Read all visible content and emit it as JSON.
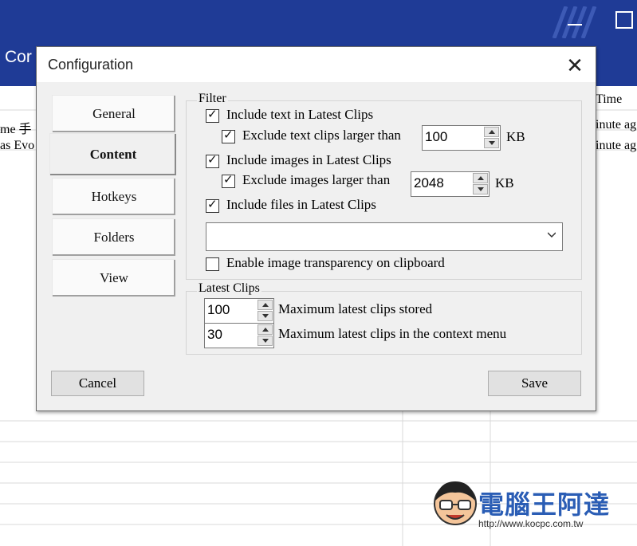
{
  "background": {
    "app_title_partial": "Cor",
    "column_header_partial": "Time",
    "row1_left_partial": "me 手",
    "row2_left_partial": "as Evo",
    "row1_right_partial": "inute ag",
    "row2_right_partial": "inute ag"
  },
  "dialog": {
    "title": "Configuration",
    "close_glyph": "✕"
  },
  "tabs": [
    {
      "label": "General",
      "active": false
    },
    {
      "label": "Content",
      "active": true
    },
    {
      "label": "Hotkeys",
      "active": false
    },
    {
      "label": "Folders",
      "active": false
    },
    {
      "label": "View",
      "active": false
    }
  ],
  "filter": {
    "group_label": "Filter",
    "include_text": {
      "label": "Include text in Latest Clips",
      "checked": true
    },
    "exclude_text": {
      "label": "Exclude text clips larger than",
      "checked": true,
      "value": "100",
      "unit": "KB"
    },
    "include_images": {
      "label": "Include images in Latest Clips",
      "checked": true
    },
    "exclude_images": {
      "label": "Exclude images larger than",
      "checked": true,
      "value": "2048",
      "unit": "KB"
    },
    "include_files": {
      "label": "Include files in Latest Clips",
      "checked": true
    },
    "dropdown_value": "",
    "transparency": {
      "label": "Enable image transparency on clipboard",
      "checked": false
    }
  },
  "latest_clips": {
    "group_label": "Latest Clips",
    "max_stored": {
      "value": "100",
      "label": "Maximum latest clips stored"
    },
    "max_context": {
      "value": "30",
      "label": "Maximum latest clips in the context menu"
    }
  },
  "buttons": {
    "cancel": "Cancel",
    "save": "Save"
  },
  "watermark": {
    "logo_text": "電腦王阿達",
    "url": "http://www.kocpc.com.tw"
  },
  "colors": {
    "titlebar_blue": "#1f3b96",
    "dialog_bg": "#f0f0f0",
    "watermark_blue": "#2a5db5"
  }
}
